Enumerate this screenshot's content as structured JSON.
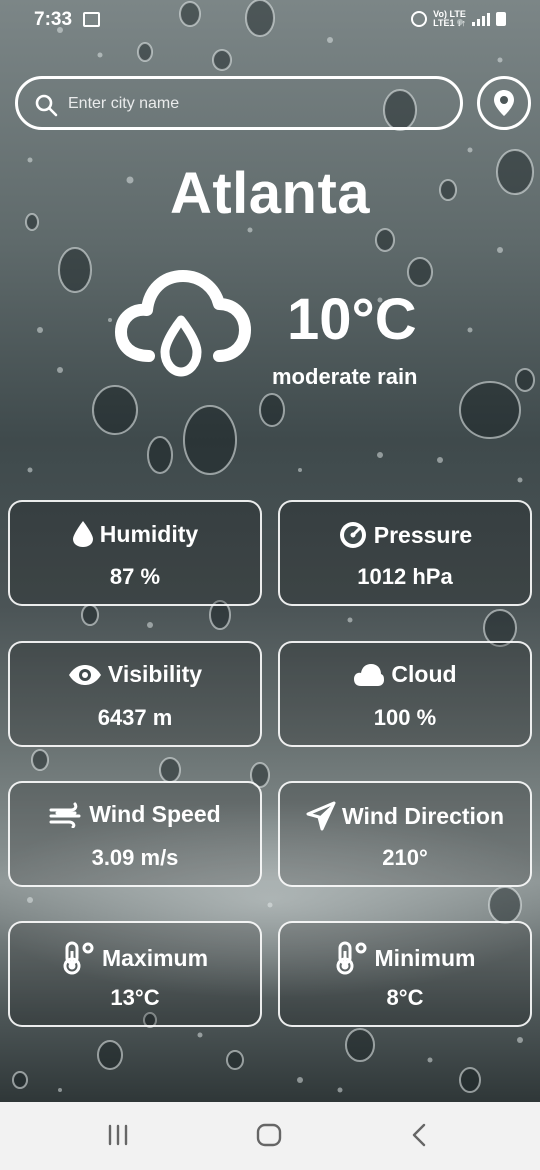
{
  "status_bar": {
    "time": "7:33",
    "network_line1": "Vo) LTE",
    "network_line2": "LTE1 ↓↑"
  },
  "search": {
    "placeholder": "Enter city name",
    "value": ""
  },
  "weather": {
    "city": "Atlanta",
    "temperature": "10°C",
    "description": "moderate rain",
    "icon": "cloud-rain-icon"
  },
  "cards": [
    {
      "label": "Humidity",
      "value": "87 %",
      "icon": "drop-icon"
    },
    {
      "label": "Pressure",
      "value": "1012 hPa",
      "icon": "gauge-icon"
    },
    {
      "label": "Visibility",
      "value": "6437 m",
      "icon": "eye-icon"
    },
    {
      "label": "Cloud",
      "value": "100 %",
      "icon": "cloud-icon"
    },
    {
      "label": "Wind Speed",
      "value": "3.09 m/s",
      "icon": "wind-icon"
    },
    {
      "label": "Wind Direction",
      "value": "210°",
      "icon": "navigation-arrow-icon"
    },
    {
      "label": "Maximum",
      "value": "13°C",
      "icon": "thermometer-icon"
    },
    {
      "label": "Minimum",
      "value": "8°C",
      "icon": "thermometer-icon"
    }
  ],
  "colors": {
    "text": "#ffffff",
    "nav_bar": "#f2f2f2",
    "nav_icons": "#666666"
  }
}
